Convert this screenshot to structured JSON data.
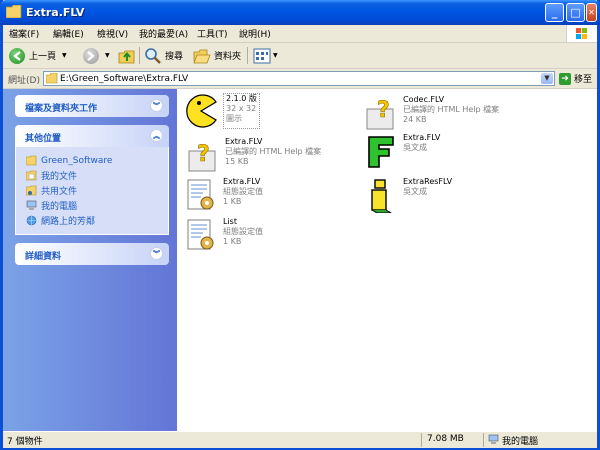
{
  "window": {
    "title": "Extra.FLV"
  },
  "title_buttons": {
    "minimize": "_",
    "maximize": "□",
    "close": "✕"
  },
  "menu": [
    "檔案(F)",
    "編輯(E)",
    "檢視(V)",
    "我的最愛(A)",
    "工具(T)",
    "說明(H)"
  ],
  "toolbar": {
    "back_label": "上一頁",
    "search_label": "搜尋",
    "folders_label": "資料夾"
  },
  "address": {
    "label": "網址(D)",
    "value": "E:\\Green_Software\\Extra.FLV",
    "go_label": "移至"
  },
  "left_pane": {
    "tasks_title": "檔案及資料夾工作",
    "other_places_title": "其他位置",
    "other_places": [
      "Green_Software",
      "我的文件",
      "共用文件",
      "我的電腦",
      "網路上的芳鄰"
    ],
    "details_title": "詳細資料"
  },
  "files": [
    {
      "name": "2.1.0 版",
      "line1": "32 x 32",
      "line2": "圖示",
      "icon": "pacman-icon"
    },
    {
      "name": "Codec.FLV",
      "line1": "已編譯的 HTML Help 檔案",
      "line2": "24 KB",
      "icon": "chm-help-icon"
    },
    {
      "name": "Extra.FLV",
      "line1": "已編譯的 HTML Help 檔案",
      "line2": "15 KB",
      "icon": "chm-help-icon"
    },
    {
      "name": "Extra.FLV",
      "line1": "吳文成",
      "line2": "",
      "icon": "green-f-app-icon"
    },
    {
      "name": "Extra.FLV",
      "line1": "組態設定值",
      "line2": "1 KB",
      "icon": "config-file-icon"
    },
    {
      "name": "ExtraResFLV",
      "line1": "吳文成",
      "line2": "",
      "icon": "yellow-app-icon"
    },
    {
      "name": "List",
      "line1": "組態設定值",
      "line2": "1 KB",
      "icon": "config-file-icon"
    }
  ],
  "status": {
    "count": "7 個物件",
    "size": "7.08 MB",
    "location": "我的電腦"
  }
}
